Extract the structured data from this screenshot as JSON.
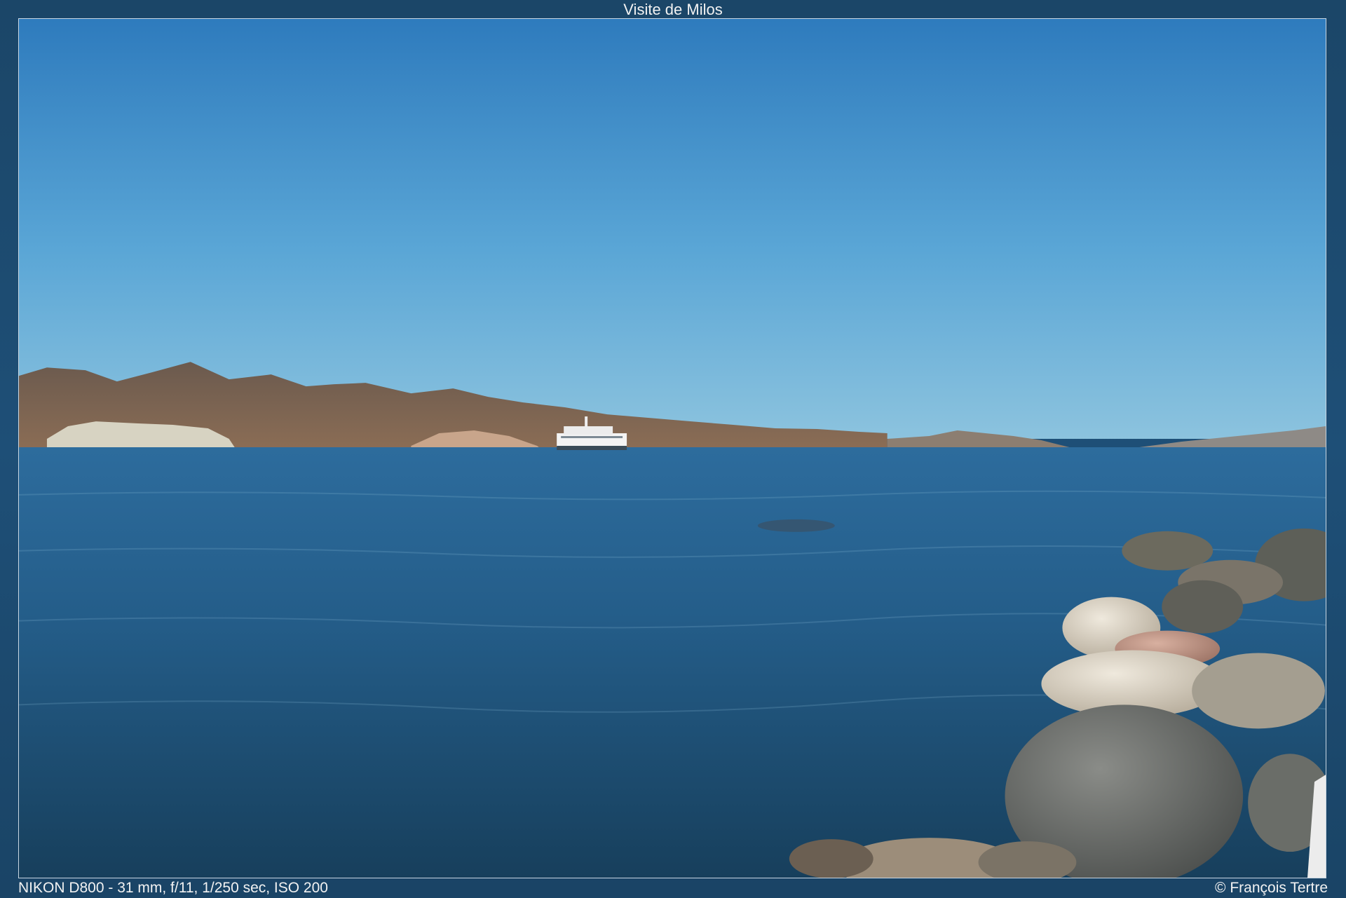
{
  "viewer": {
    "title": "Visite de Milos",
    "exif": "NIKON D800 - 31 mm, f/11, 1/250 sec, ISO 200",
    "credit": "© François Tertre"
  },
  "photo": {
    "scene": "sea-coast-with-ferry-and-rocks",
    "colors": {
      "sky_top": "#2f7fc0",
      "sky_bottom": "#86c1dd",
      "sea_far": "#2f6e9f",
      "sea_near": "#1a4d70",
      "hills": "#7a6656",
      "rocks": "#8a8980"
    }
  }
}
